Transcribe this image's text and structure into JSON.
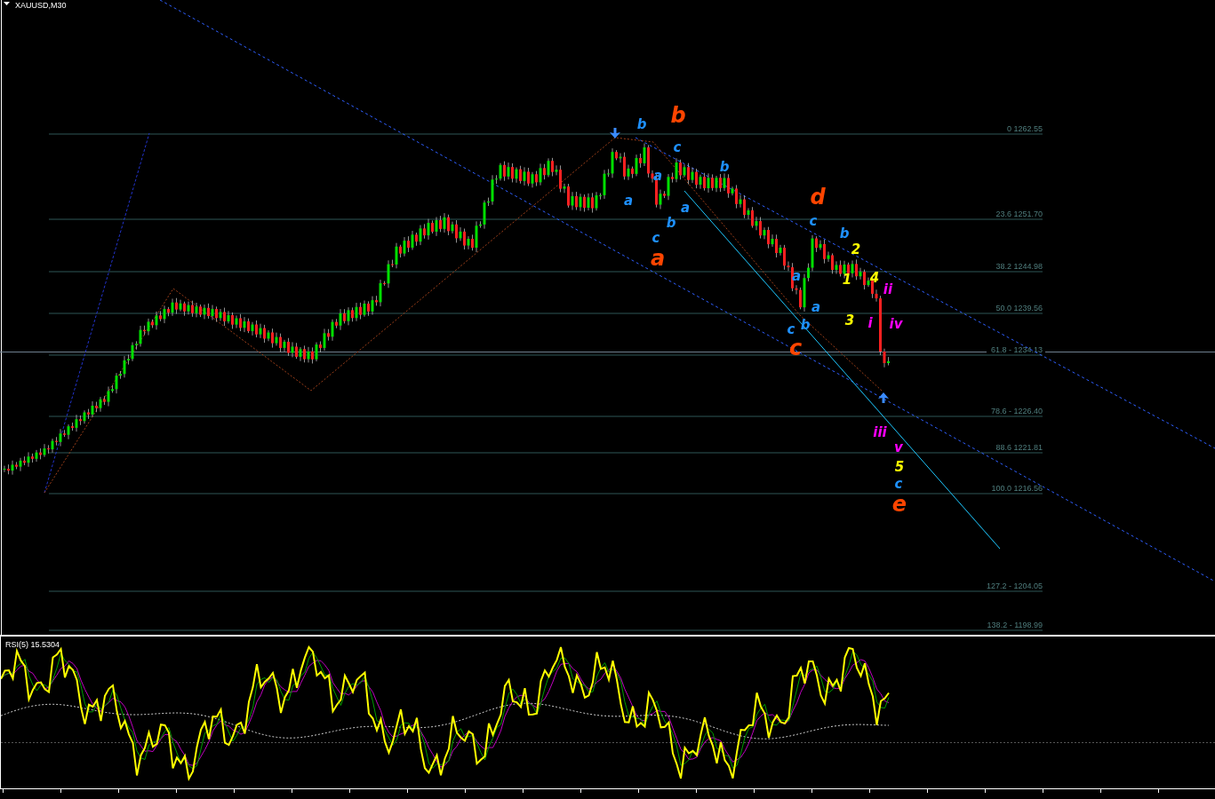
{
  "chart": {
    "symbol_label": "XAUUSD,M30",
    "fib_levels": [
      {
        "label": "0 1262.55"
      },
      {
        "label": "23.6 1251.70"
      },
      {
        "label": "38.2 1244.98"
      },
      {
        "label": "50.0 1239.56"
      },
      {
        "label": "61.8 - 1234.13"
      },
      {
        "label": "78.6 - 1226.40"
      },
      {
        "label": "88.6 1221.81"
      },
      {
        "label": "100.0 1216.56"
      },
      {
        "label": "127.2 - 1204.05"
      },
      {
        "label": "138.2 - 1198.99"
      }
    ],
    "wave_labels": [
      {
        "text": "b",
        "color": "#1e90ff",
        "kind": "minor"
      },
      {
        "text": "b",
        "color": "#ff4500",
        "kind": "major"
      },
      {
        "text": "c",
        "color": "#1e90ff",
        "kind": "minor"
      },
      {
        "text": "b",
        "color": "#1e90ff",
        "kind": "minor"
      },
      {
        "text": "a",
        "color": "#1e90ff",
        "kind": "minor"
      },
      {
        "text": "a",
        "color": "#1e90ff",
        "kind": "minor"
      },
      {
        "text": "a",
        "color": "#1e90ff",
        "kind": "minor"
      },
      {
        "text": "b",
        "color": "#1e90ff",
        "kind": "minor"
      },
      {
        "text": "c",
        "color": "#1e90ff",
        "kind": "minor"
      },
      {
        "text": "a",
        "color": "#ff4500",
        "kind": "major"
      },
      {
        "text": "d",
        "color": "#ff4500",
        "kind": "major"
      },
      {
        "text": "c",
        "color": "#1e90ff",
        "kind": "minor"
      },
      {
        "text": "b",
        "color": "#1e90ff",
        "kind": "minor"
      },
      {
        "text": "2",
        "color": "#ffff00",
        "kind": "minor"
      },
      {
        "text": "1",
        "color": "#ffff00",
        "kind": "minor"
      },
      {
        "text": "4",
        "color": "#ffff00",
        "kind": "minor"
      },
      {
        "text": "ii",
        "color": "#ff00ff",
        "kind": "minor"
      },
      {
        "text": "a",
        "color": "#1e90ff",
        "kind": "minor"
      },
      {
        "text": "a",
        "color": "#1e90ff",
        "kind": "minor"
      },
      {
        "text": "3",
        "color": "#ffff00",
        "kind": "minor"
      },
      {
        "text": "i",
        "color": "#ff00ff",
        "kind": "minor"
      },
      {
        "text": "iv",
        "color": "#ff00ff",
        "kind": "minor"
      },
      {
        "text": "c",
        "color": "#1e90ff",
        "kind": "minor"
      },
      {
        "text": "b",
        "color": "#1e90ff",
        "kind": "minor"
      },
      {
        "text": "c",
        "color": "#ff4500",
        "kind": "major"
      },
      {
        "text": "iii",
        "color": "#ff00ff",
        "kind": "minor"
      },
      {
        "text": "v",
        "color": "#ff00ff",
        "kind": "minor"
      },
      {
        "text": "5",
        "color": "#ffff00",
        "kind": "minor"
      },
      {
        "text": "c",
        "color": "#1e90ff",
        "kind": "minor"
      },
      {
        "text": "e",
        "color": "#ff4500",
        "kind": "major"
      }
    ]
  },
  "indicator": {
    "label": "RSI(5) 15.5304"
  }
}
